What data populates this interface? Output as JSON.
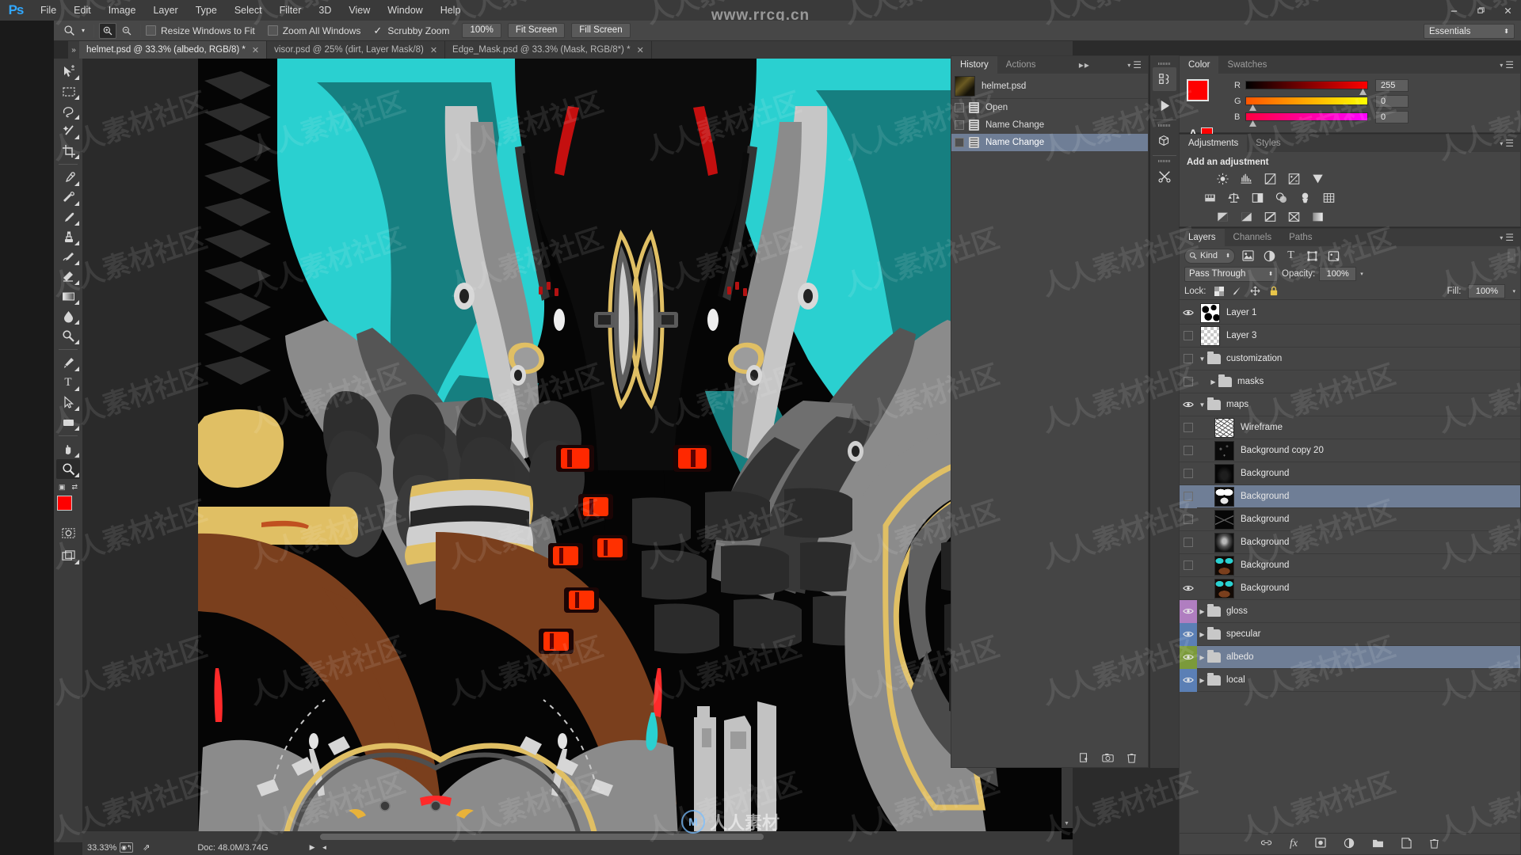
{
  "app": {
    "name": "Ps",
    "watermark_top": "www.rrcg.cn",
    "watermark_center": "人人素材",
    "watermark_tile": "人人素材社区"
  },
  "menubar": {
    "items": [
      "File",
      "Edit",
      "Image",
      "Layer",
      "Type",
      "Select",
      "Filter",
      "3D",
      "View",
      "Window",
      "Help"
    ],
    "window_controls": [
      "minimize-icon",
      "restore-icon",
      "close-icon"
    ]
  },
  "options_bar": {
    "tool_icon": "zoom-icon",
    "zoom_in_icon": "zoom-in-icon",
    "zoom_out_icon": "zoom-out-icon",
    "resize_windows_label": "Resize Windows to Fit",
    "zoom_all_label": "Zoom All Windows",
    "scrubby_label": "Scrubby Zoom",
    "scrubby_checked": true,
    "pct_button": "100%",
    "fit_screen": "Fit Screen",
    "fill_screen": "Fill Screen",
    "workspace": "Essentials"
  },
  "tabs": [
    {
      "label": "helmet.psd @ 33.3% (albedo, RGB/8) *",
      "active": true
    },
    {
      "label": "visor.psd @ 25% (dirt, Layer Mask/8)",
      "active": false
    },
    {
      "label": "Edge_Mask.psd @ 33.3% (Mask, RGB/8*) *",
      "active": false
    }
  ],
  "toolbox": [
    {
      "name": "move-tool",
      "selected": false
    },
    {
      "name": "rectangular-marquee-tool",
      "selected": false
    },
    {
      "name": "lasso-tool",
      "selected": false
    },
    {
      "name": "magic-wand-tool",
      "selected": false
    },
    {
      "name": "crop-tool",
      "selected": false
    },
    {
      "name": "eyedropper-tool",
      "selected": false
    },
    {
      "name": "spot-healing-brush-tool",
      "selected": false
    },
    {
      "name": "brush-tool",
      "selected": false
    },
    {
      "name": "clone-stamp-tool",
      "selected": false
    },
    {
      "name": "history-brush-tool",
      "selected": false
    },
    {
      "name": "eraser-tool",
      "selected": false
    },
    {
      "name": "gradient-tool",
      "selected": false
    },
    {
      "name": "blur-tool",
      "selected": false
    },
    {
      "name": "dodge-tool",
      "selected": false
    },
    {
      "name": "pen-tool",
      "selected": false
    },
    {
      "name": "type-tool",
      "selected": false
    },
    {
      "name": "path-selection-tool",
      "selected": false
    },
    {
      "name": "rectangle-tool",
      "selected": false
    },
    {
      "name": "hand-tool",
      "selected": false
    },
    {
      "name": "zoom-tool",
      "selected": true
    }
  ],
  "colors": {
    "foreground": "#fe0000",
    "background": "#ffffff",
    "accent_blue": "#31a8ff",
    "selection_blue": "#6f7e96",
    "panel_bg": "#454545",
    "panel_dark": "#3b3b3b"
  },
  "history": {
    "tabs": [
      {
        "label": "History",
        "active": true
      },
      {
        "label": "Actions",
        "active": false
      }
    ],
    "document": "helmet.psd",
    "states": [
      {
        "label": "Open",
        "selected": false
      },
      {
        "label": "Name Change",
        "selected": false
      },
      {
        "label": "Name Change",
        "selected": true
      }
    ],
    "footer_icons": [
      "new-document-from-state-icon",
      "new-snapshot-icon",
      "delete-icon"
    ]
  },
  "icon_dock": [
    "adjustments-collapsed-icon",
    "play-icon",
    "3d-icon",
    "tools-icon"
  ],
  "color_panel": {
    "tabs": [
      {
        "label": "Color",
        "active": true
      },
      {
        "label": "Swatches",
        "active": false
      }
    ],
    "channels": [
      {
        "label": "R",
        "value": "255"
      },
      {
        "label": "G",
        "value": "0"
      },
      {
        "label": "B",
        "value": "0"
      }
    ],
    "alpha_icon": "A",
    "foreground": "#fe0000",
    "background": "#ffffff"
  },
  "adjustments_panel": {
    "tabs": [
      {
        "label": "Adjustments",
        "active": true
      },
      {
        "label": "Styles",
        "active": false
      }
    ],
    "title": "Add an adjustment",
    "row1": [
      "brightness-contrast-icon",
      "levels-icon",
      "curves-icon",
      "exposure-icon",
      "vibrance-icon"
    ],
    "row2": [
      "hue-saturation-icon",
      "color-balance-icon",
      "black-white-icon",
      "photo-filter-icon",
      "channel-mixer-icon",
      "color-lookup-icon"
    ],
    "row3": [
      "invert-icon",
      "posterize-icon",
      "threshold-icon",
      "selective-color-icon",
      "gradient-map-icon"
    ]
  },
  "layers_panel": {
    "tabs": [
      {
        "label": "Layers",
        "active": true
      },
      {
        "label": "Channels",
        "active": false
      },
      {
        "label": "Paths",
        "active": false
      }
    ],
    "filter_kind": "Kind",
    "filter_icons": [
      "pixel-filter-icon",
      "adjustment-filter-icon",
      "type-filter-icon",
      "shape-filter-icon",
      "smart-object-filter-icon"
    ],
    "blend_mode": "Pass Through",
    "opacity_label": "Opacity:",
    "opacity_value": "100%",
    "lock_label": "Lock:",
    "lock_icons": [
      "lock-transparent-pixels-icon",
      "lock-image-pixels-icon",
      "lock-position-icon",
      "lock-all-icon"
    ],
    "fill_label": "Fill:",
    "fill_value": "100%",
    "rows": [
      {
        "name": "Layer 1",
        "visible": true,
        "kind": "image",
        "indent": 0,
        "selected": false,
        "thumb": "noise-bw"
      },
      {
        "name": "Layer 3",
        "visible": false,
        "kind": "image",
        "indent": 0,
        "selected": false,
        "thumb": "checker"
      },
      {
        "name": "customization",
        "visible": false,
        "kind": "group",
        "indent": 0,
        "selected": false,
        "expanded": true
      },
      {
        "name": "masks",
        "visible": false,
        "kind": "group",
        "indent": 1,
        "selected": false,
        "expanded": false
      },
      {
        "name": "maps",
        "visible": true,
        "kind": "group",
        "indent": 0,
        "selected": false,
        "expanded": true
      },
      {
        "name": "Wireframe",
        "visible": false,
        "kind": "image",
        "indent": 1,
        "selected": false,
        "thumb": "wire"
      },
      {
        "name": "Background copy 20",
        "visible": false,
        "kind": "image",
        "indent": 1,
        "selected": false,
        "thumb": "darkspeck"
      },
      {
        "name": "Background",
        "visible": false,
        "kind": "image",
        "indent": 1,
        "selected": false,
        "thumb": "nearblack"
      },
      {
        "name": "Background",
        "visible": false,
        "kind": "image",
        "indent": 1,
        "selected": true,
        "thumb": "whiteblob"
      },
      {
        "name": "Background",
        "visible": false,
        "kind": "image",
        "indent": 1,
        "selected": false,
        "thumb": "edgemask"
      },
      {
        "name": "Background",
        "visible": false,
        "kind": "image",
        "indent": 1,
        "selected": false,
        "thumb": "gray"
      },
      {
        "name": "Background",
        "visible": false,
        "kind": "image",
        "indent": 1,
        "selected": false,
        "thumb": "color"
      },
      {
        "name": "Background",
        "visible": true,
        "kind": "image",
        "indent": 1,
        "selected": false,
        "thumb": "color"
      },
      {
        "name": "gloss",
        "visible": true,
        "kind": "group",
        "indent": 0,
        "selected": false,
        "expanded": false,
        "eye_color": "#b07ec0"
      },
      {
        "name": "specular",
        "visible": true,
        "kind": "group",
        "indent": 0,
        "selected": false,
        "expanded": false,
        "eye_color": "#5b7fb5"
      },
      {
        "name": "albedo",
        "visible": true,
        "kind": "group",
        "indent": 0,
        "selected": true,
        "expanded": false,
        "eye_color": "#7b9a3a"
      },
      {
        "name": "local",
        "visible": true,
        "kind": "group",
        "indent": 0,
        "selected": false,
        "expanded": false,
        "eye_color": "#5b7fb5"
      }
    ],
    "footer_icons": [
      "link-layers-icon",
      "layer-style-fx-icon",
      "add-layer-mask-icon",
      "new-adjustment-layer-icon",
      "new-group-icon",
      "new-layer-icon",
      "delete-layer-icon"
    ]
  },
  "status_bar": {
    "zoom": "33.33%",
    "doc_label": "Doc: 48.0M/3.74G",
    "icons": [
      "camera-raw-icon",
      "share-icon",
      "play-icon"
    ]
  },
  "canvas": {
    "document": "helmet.psd",
    "zoom_level": "33.3%",
    "palette": {
      "black": "#050505",
      "cyan_bright": "#2ad0d0",
      "cyan_dark": "#167f80",
      "gray_light": "#c6c6c6",
      "gray_mid": "#8b8b8b",
      "gray_dark": "#3a3a3a",
      "gray_darker": "#262626",
      "gold": "#e0bf64",
      "gold_dark": "#c39b3d",
      "brown": "#7a3f1d",
      "red": "#ff1a1a",
      "red_dark": "#8a1010"
    }
  }
}
